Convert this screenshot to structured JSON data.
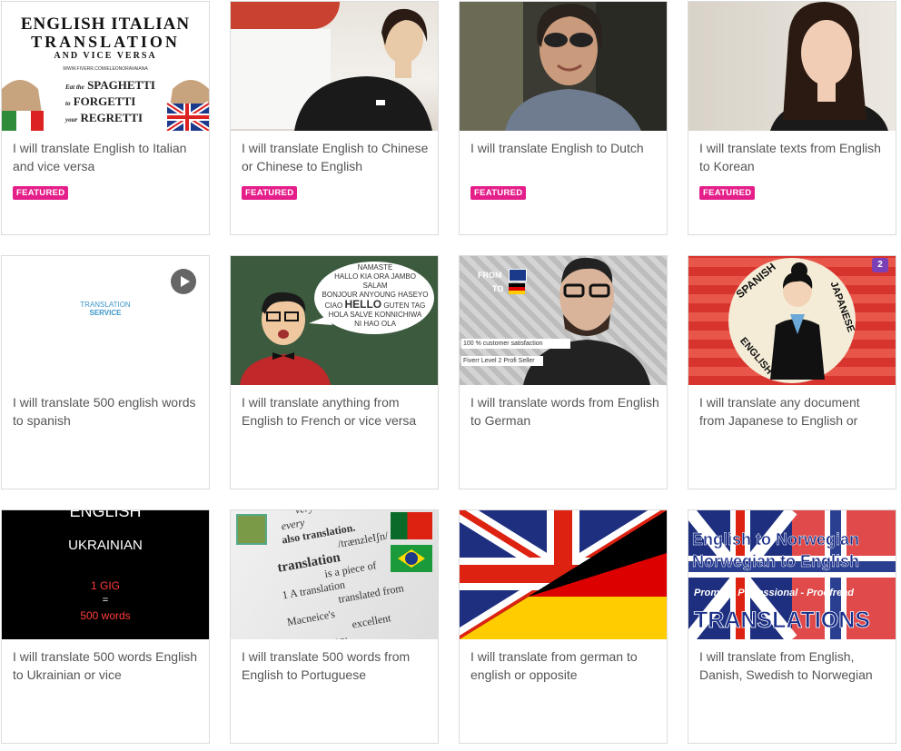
{
  "featured_label": "FEATURED",
  "gigs": [
    {
      "title": "I will translate English to Italian and vice versa",
      "featured": true
    },
    {
      "title": "I will translate English to Chinese or Chinese to English",
      "featured": true
    },
    {
      "title": "I will translate English to Dutch",
      "featured": true
    },
    {
      "title": "I will translate texts from English to Korean",
      "featured": true
    },
    {
      "title": "I will translate 500 english words to spanish",
      "featured": false
    },
    {
      "title": "I will translate anything from English to French or vice versa",
      "featured": false
    },
    {
      "title": "I will translate words from English to German",
      "featured": false
    },
    {
      "title": "I will translate any document from Japanese to English or",
      "featured": false
    },
    {
      "title": "I will translate 500 words English to Ukrainian or vice",
      "featured": false
    },
    {
      "title": "I will translate 500 words from English to Portuguese",
      "featured": false
    },
    {
      "title": "I will translate from german to english or opposite",
      "featured": false
    },
    {
      "title": "I will translate from English, Danish, Swedish to Norwegian",
      "featured": false
    }
  ],
  "thumb_text": {
    "italian": {
      "line1": "ENGLISH ITALIAN",
      "line2": "TRANSLATION",
      "line3": "AND VICE VERSA",
      "url": "WWW.FIVERR.COM/ELEONORAVAIANA",
      "tag1": "Eat the",
      "tag2": "SPAGHETTI",
      "tag3": "FORGETTI",
      "tag4": "your",
      "tag5": "REGRETTI"
    },
    "spanish": {
      "line1": "TRANSLATION",
      "line2": "SERVICE"
    },
    "french": {
      "words": [
        "NAMASTE",
        "HALLO",
        "KIA ORA",
        "JAMBO",
        "SALAM",
        "BONJOUR",
        "ANYOUNG",
        "HASEYO",
        "CIAO",
        "HELLO",
        "GUTEN TAG",
        "HOLA",
        "SALVE",
        "KONNICHIWA",
        "NI HAO",
        "OLA"
      ]
    },
    "german": {
      "from": "FROM",
      "to": "TO",
      "sat": "100 % customer satisfaction",
      "lvl": "Fiverr Level 2 Profi Seller"
    },
    "japanese": {
      "a": "SPANISH",
      "b": "JAPANESE",
      "c": "ENGLISH",
      "num": "2"
    },
    "ukrainian": {
      "a": "ENGLISH",
      "b": "UKRAINIAN",
      "c": "1 GIG",
      "d": "=",
      "e": "500 words"
    },
    "portuguese": {
      "l1": "very single person",
      "l2": "every",
      "l3": "also translation.",
      "l4": "/trænzleIʃn/",
      "l5": "translation",
      "l6": "is a piece of",
      "l7": "1 A translation",
      "l8": "translated from",
      "l9": "Macneice's",
      "l10": "excellent",
      "l11": "of the Poetry"
    },
    "norwegian": {
      "a": "English to Norwegian",
      "b": "Norwegian to English",
      "c": "Prompt - Professional - Proofread",
      "d": "TRANSLATIONS"
    }
  },
  "colors": {
    "featured": "#e51f8a",
    "title": "#555555",
    "border": "#dcdcdc"
  }
}
